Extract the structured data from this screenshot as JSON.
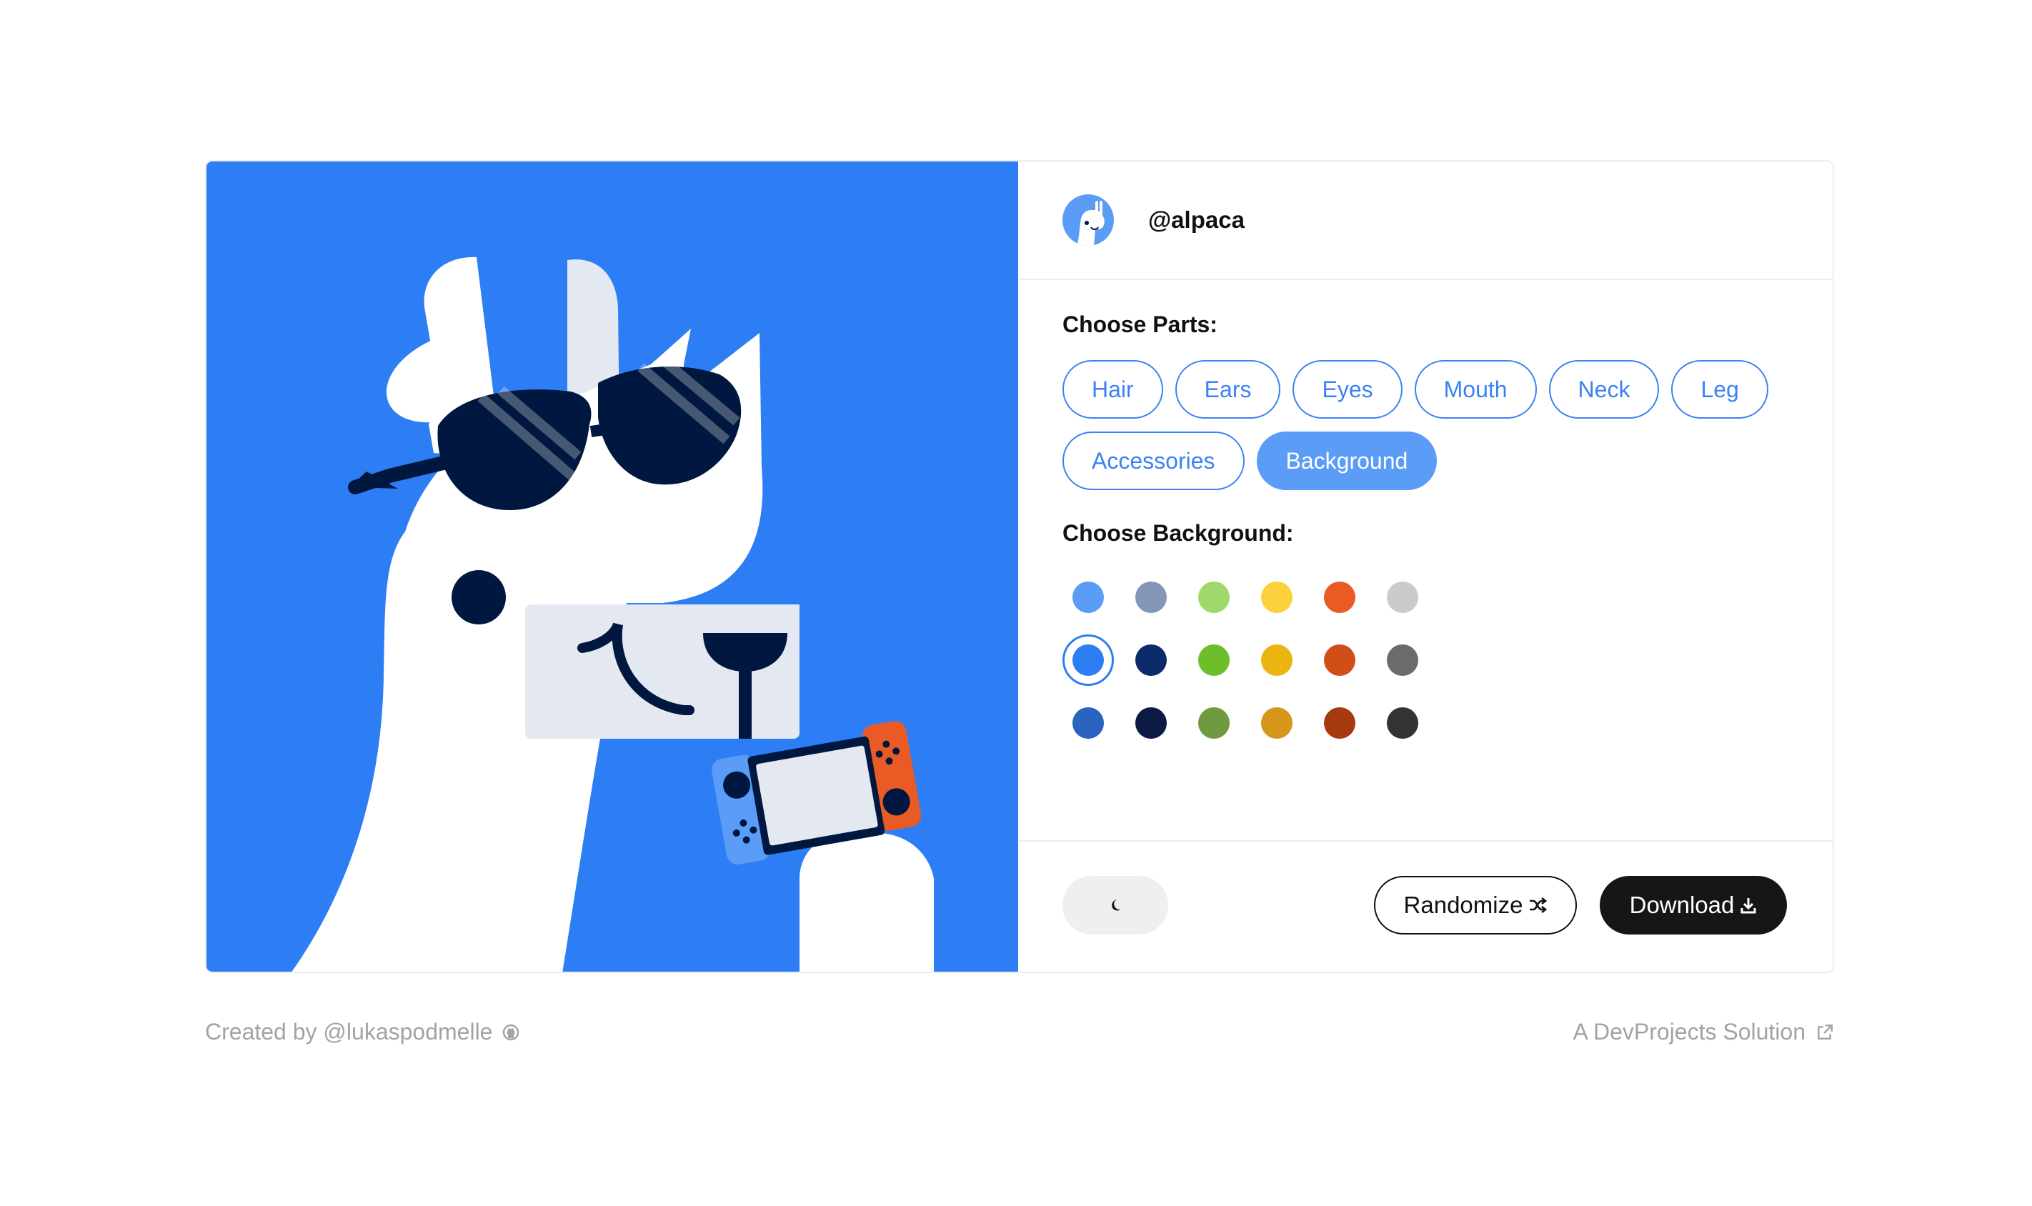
{
  "app": {
    "username": "@alpaca"
  },
  "parts_section": {
    "title": "Choose Parts:",
    "items": [
      {
        "label": "Hair",
        "active": false
      },
      {
        "label": "Ears",
        "active": false
      },
      {
        "label": "Eyes",
        "active": false
      },
      {
        "label": "Mouth",
        "active": false
      },
      {
        "label": "Neck",
        "active": false
      },
      {
        "label": "Leg",
        "active": false
      },
      {
        "label": "Accessories",
        "active": false
      },
      {
        "label": "Background",
        "active": true
      }
    ]
  },
  "background_section": {
    "title": "Choose Background:",
    "selected_index": 6,
    "colors": [
      "#5a9cf6",
      "#8497b8",
      "#9fd86b",
      "#fdd13e",
      "#ea5a24",
      "#cbcbcb",
      "#2d7ef4",
      "#0d2a6b",
      "#6cbe2a",
      "#eab511",
      "#d24e18",
      "#6b6b6b",
      "#2a62c0",
      "#0a1a44",
      "#6f9a3f",
      "#d6961a",
      "#a53a0f",
      "#333333"
    ]
  },
  "actions": {
    "theme_icon": "moon-icon",
    "randomize_label": "Randomize",
    "randomize_icon": "shuffle-icon",
    "download_label": "Download",
    "download_icon": "download-icon"
  },
  "footer": {
    "created_by": "Created by @lukaspodmelle",
    "created_by_icon": "github-icon",
    "solution": "A DevProjects Solution",
    "solution_icon": "external-link-icon"
  },
  "preview": {
    "background_color": "#2d7ef4",
    "body_color": "#ffffff",
    "muzzle_color": "#e3e8f1",
    "dark_color": "#00183f",
    "accessory": "sunglasses",
    "item": "game-console"
  }
}
